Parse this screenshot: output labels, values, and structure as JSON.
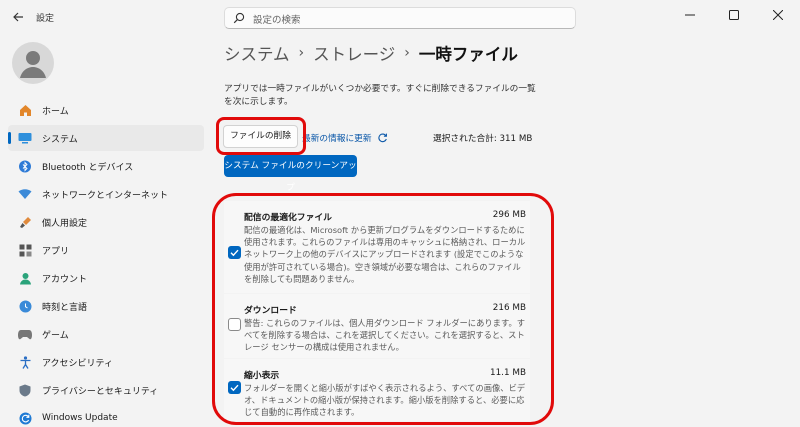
{
  "window": {
    "title": "設定",
    "controls": [
      "minimize-icon",
      "maximize-icon",
      "close-icon"
    ]
  },
  "search": {
    "placeholder": "設定の検索"
  },
  "sidebar": {
    "items": [
      {
        "label": "ホーム",
        "icon": "home-icon"
      },
      {
        "label": "システム",
        "icon": "system-icon",
        "active": true
      },
      {
        "label": "Bluetooth とデバイス",
        "icon": "bluetooth-icon"
      },
      {
        "label": "ネットワークとインターネット",
        "icon": "network-icon"
      },
      {
        "label": "個人用設定",
        "icon": "brush-icon"
      },
      {
        "label": "アプリ",
        "icon": "apps-icon"
      },
      {
        "label": "アカウント",
        "icon": "account-icon"
      },
      {
        "label": "時刻と言語",
        "icon": "globe-clock-icon"
      },
      {
        "label": "ゲーム",
        "icon": "gamepad-icon"
      },
      {
        "label": "アクセシビリティ",
        "icon": "accessibility-icon"
      },
      {
        "label": "プライバシーとセキュリティ",
        "icon": "shield-icon"
      },
      {
        "label": "Windows Update",
        "icon": "update-icon"
      }
    ]
  },
  "breadcrumb": {
    "part1": "システム",
    "part2": "ストレージ",
    "current": "一時ファイル",
    "separator": "›"
  },
  "description": "アプリでは一時ファイルがいくつか必要です。すぐに削除できるファイルの一覧を次に示します。",
  "actions": {
    "delete_label": "ファイルの削除",
    "refresh_label": "最新の情報に更新",
    "total_label": "選択された合計: 311 MB",
    "cleanup_label": "システム ファイルのクリーンアップ"
  },
  "files": [
    {
      "name": "配信の最適化ファイル",
      "size": "296 MB",
      "checked": true,
      "description": "配信の最適化は、Microsoft から更新プログラムをダウンロードするために使用されます。これらのファイルは専用のキャッシュに格納され、ローカル ネットワーク上の他のデバイスにアップロードされます (設定でこのような使用が許可されている場合)。空き領域が必要な場合は、これらのファイルを削除しても問題ありません。"
    },
    {
      "name": "ダウンロード",
      "size": "216 MB",
      "checked": false,
      "description": "警告: これらのファイルは、個人用ダウンロード フォルダーにあります。すべてを削除する場合は、これを選択してください。これを選択すると、ストレージ センサーの構成は使用されません。"
    },
    {
      "name": "縮小表示",
      "size": "11.1 MB",
      "checked": true,
      "description": "フォルダーを開くと縮小版がすばやく表示されるよう、すべての画像、ビデオ、ドキュメントの縮小版が保持されます。縮小版を削除すると、必要に応じて自動的に再作成されます。"
    }
  ],
  "colors": {
    "accent": "#0067c0",
    "highlight": "#e10a0a",
    "background": "#f3f3f3"
  }
}
